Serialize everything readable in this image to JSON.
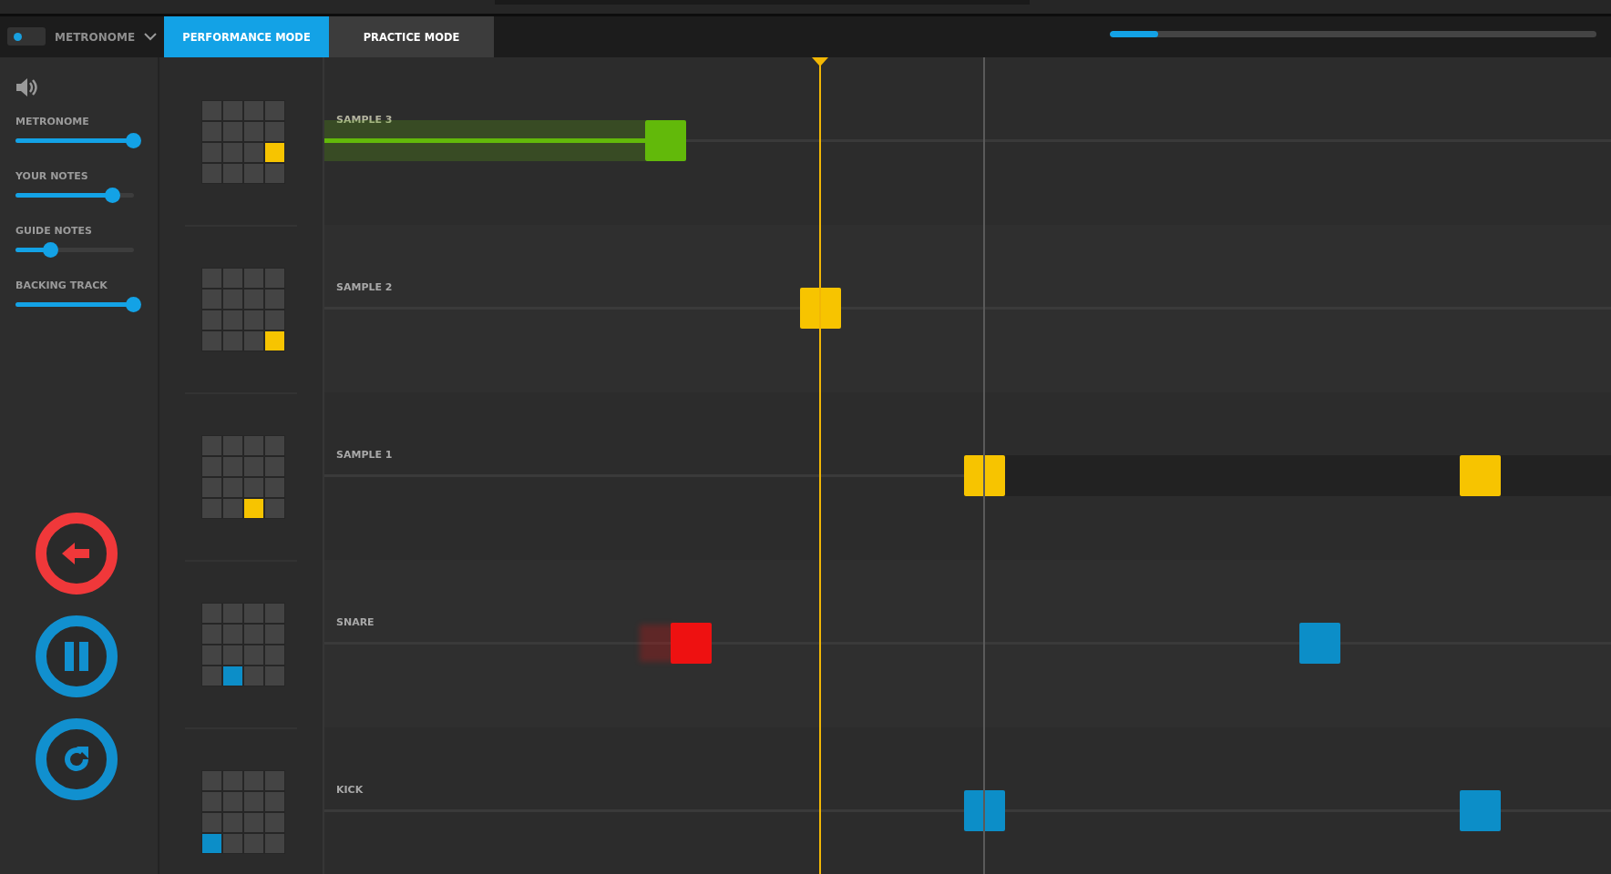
{
  "header": {
    "metronome_toggle": {
      "on": true
    },
    "metronome_menu": "METRONOME",
    "tabs": [
      {
        "label": "PERFORMANCE MODE",
        "selected": true
      },
      {
        "label": "PRACTICE MODE",
        "selected": false
      }
    ],
    "progress": {
      "level": 0.1
    }
  },
  "mixer": {
    "sliders": [
      {
        "label": "METRONOME",
        "level": 1.0
      },
      {
        "label": "YOUR NOTES",
        "level": 0.82
      },
      {
        "label": "GUIDE NOTES",
        "level": 0.3
      },
      {
        "label": "BACKING TRACK",
        "level": 1.0
      }
    ]
  },
  "controls": [
    {
      "kind": "back"
    },
    {
      "kind": "pause"
    },
    {
      "kind": "restart"
    }
  ],
  "lanes": [
    {
      "label": "SAMPLE 3",
      "pad": [
        [
          {
            "lit": false
          },
          {
            "lit": false
          },
          {
            "lit": false
          },
          {
            "lit": false
          }
        ],
        [
          {
            "lit": false
          },
          {
            "lit": false
          },
          {
            "lit": false
          },
          {
            "lit": false
          }
        ],
        [
          {
            "lit": false
          },
          {
            "lit": false
          },
          {
            "lit": false
          },
          {
            "lit": true
          }
        ],
        [
          {
            "lit": false
          },
          {
            "lit": false
          },
          {
            "lit": false
          },
          {
            "lit": false
          }
        ]
      ],
      "color": "#f7c400",
      "notes": [
        {
          "kind": "held",
          "color": "#62b90a"
        }
      ]
    },
    {
      "label": "SAMPLE 2",
      "pad": [
        [
          {
            "lit": false
          },
          {
            "lit": false
          },
          {
            "lit": false
          },
          {
            "lit": false
          }
        ],
        [
          {
            "lit": false
          },
          {
            "lit": false
          },
          {
            "lit": false
          },
          {
            "lit": false
          }
        ],
        [
          {
            "lit": false
          },
          {
            "lit": false
          },
          {
            "lit": false
          },
          {
            "lit": false
          }
        ],
        [
          {
            "lit": false
          },
          {
            "lit": false
          },
          {
            "lit": false
          },
          {
            "lit": true
          }
        ]
      ],
      "color": "#f7c400",
      "notes": [
        {
          "kind": "upcoming",
          "color": "#f7c400"
        }
      ]
    },
    {
      "label": "SAMPLE 1",
      "pad": [
        [
          {
            "lit": false
          },
          {
            "lit": false
          },
          {
            "lit": false
          },
          {
            "lit": false
          }
        ],
        [
          {
            "lit": false
          },
          {
            "lit": false
          },
          {
            "lit": false
          },
          {
            "lit": false
          }
        ],
        [
          {
            "lit": false
          },
          {
            "lit": false
          },
          {
            "lit": false
          },
          {
            "lit": false
          }
        ],
        [
          {
            "lit": false
          },
          {
            "lit": false
          },
          {
            "lit": true
          },
          {
            "lit": false
          }
        ]
      ],
      "color": "#f7c400",
      "notes": [
        {
          "kind": "long",
          "color": "#f7c400"
        },
        {
          "kind": "upcoming",
          "color": "#f7c400"
        }
      ]
    },
    {
      "label": "SNARE",
      "pad": [
        [
          {
            "lit": false
          },
          {
            "lit": false
          },
          {
            "lit": false
          },
          {
            "lit": false
          }
        ],
        [
          {
            "lit": false
          },
          {
            "lit": false
          },
          {
            "lit": false
          },
          {
            "lit": false
          }
        ],
        [
          {
            "lit": false
          },
          {
            "lit": false
          },
          {
            "lit": false
          },
          {
            "lit": false
          }
        ],
        [
          {
            "lit": false
          },
          {
            "lit": true
          },
          {
            "lit": false
          },
          {
            "lit": false
          }
        ]
      ],
      "color": "#0c8ec8",
      "notes": [
        {
          "kind": "missed",
          "color": "#ee1111"
        },
        {
          "kind": "upcoming",
          "color": "#0c8ec8"
        }
      ]
    },
    {
      "label": "KICK",
      "pad": [
        [
          {
            "lit": false
          },
          {
            "lit": false
          },
          {
            "lit": false
          },
          {
            "lit": false
          }
        ],
        [
          {
            "lit": false
          },
          {
            "lit": false
          },
          {
            "lit": false
          },
          {
            "lit": false
          }
        ],
        [
          {
            "lit": false
          },
          {
            "lit": false
          },
          {
            "lit": false
          },
          {
            "lit": false
          }
        ],
        [
          {
            "lit": true
          },
          {
            "lit": false
          },
          {
            "lit": false
          },
          {
            "lit": false
          }
        ]
      ],
      "color": "#0c8ec8",
      "notes": [
        {
          "kind": "upcoming",
          "color": "#0c8ec8"
        },
        {
          "kind": "upcoming",
          "color": "#0c8ec8"
        }
      ]
    }
  ]
}
